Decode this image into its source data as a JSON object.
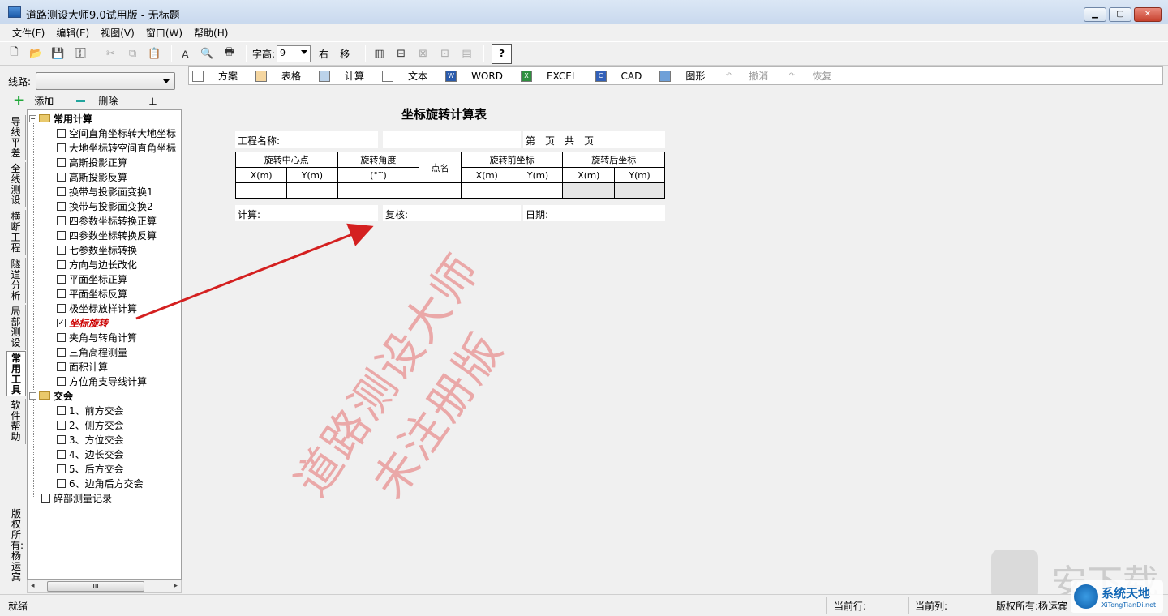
{
  "window": {
    "title": "道路测设大师9.0试用版 - 无标题"
  },
  "menu": [
    "文件(F)",
    "编辑(E)",
    "视图(V)",
    "窗口(W)",
    "帮助(H)"
  ],
  "toolbar": {
    "font_label": "字高:",
    "font_value": "9",
    "right_label": "右",
    "move_label": "移"
  },
  "left": {
    "route_label": "线路:",
    "add_label": "添加",
    "delete_label": "删除",
    "pin_icon": "pin-icon",
    "vtabs": [
      "导线平差",
      "全线测设",
      "横断工程",
      "隧道分析",
      "局部测设",
      "常用工具",
      "软件帮助",
      "版权所有:杨运宾"
    ],
    "tree": {
      "group1": "常用计算",
      "items1": [
        "空间直角坐标转大地坐标",
        "大地坐标转空间直角坐标",
        "高斯投影正算",
        "高斯投影反算",
        "换带与投影面变换1",
        "换带与投影面变换2",
        "四参数坐标转换正算",
        "四参数坐标转换反算",
        "七参数坐标转换",
        "方向与边长改化",
        "平面坐标正算",
        "平面坐标反算",
        "极坐标放样计算",
        "坐标旋转",
        "夹角与转角计算",
        "三角高程测量",
        "面积计算",
        "方位角支导线计算"
      ],
      "checked_index": 13,
      "group2": "交会",
      "items2": [
        "1、前方交会",
        "2、侧方交会",
        "3、方位交会",
        "4、边长交会",
        "5、后方交会",
        "6、边角后方交会"
      ],
      "last": "碎部测量记录"
    }
  },
  "doc_toolbar": [
    "方案",
    "表格",
    "计算",
    "文本",
    "WORD",
    "EXCEL",
    "CAD",
    "图形",
    "撤消",
    "恢复"
  ],
  "report": {
    "title": "坐标旋转计算表",
    "project_label": "工程名称:",
    "page_label": "第　页　共　页",
    "calc_label": "计算:",
    "check_label": "复核:",
    "date_label": "日期:",
    "headers": [
      "旋转中心点",
      "旋转角度",
      "点名",
      "旋转前坐标",
      "旋转后坐标"
    ],
    "subheaders": [
      "X(m)",
      "Y(ｍ)",
      "(°′″)",
      "X(ｍ)",
      "Y(ｍ)",
      "X(ｍ)",
      "Y(ｍ)"
    ]
  },
  "watermark": [
    "道路测设大师",
    "未注册版"
  ],
  "status": {
    "ready": "就绪",
    "current_row": "当前行:",
    "current_col": "当前列:",
    "copyright": "版权所有:杨运宾"
  },
  "logo": {
    "name": "系统天地",
    "url": "XiTongTianDi.net"
  },
  "ghost_logo": "安下载",
  "colors": {
    "accent": "#1267b5",
    "watermark": "#e66e6e",
    "arrow": "#d42020"
  }
}
